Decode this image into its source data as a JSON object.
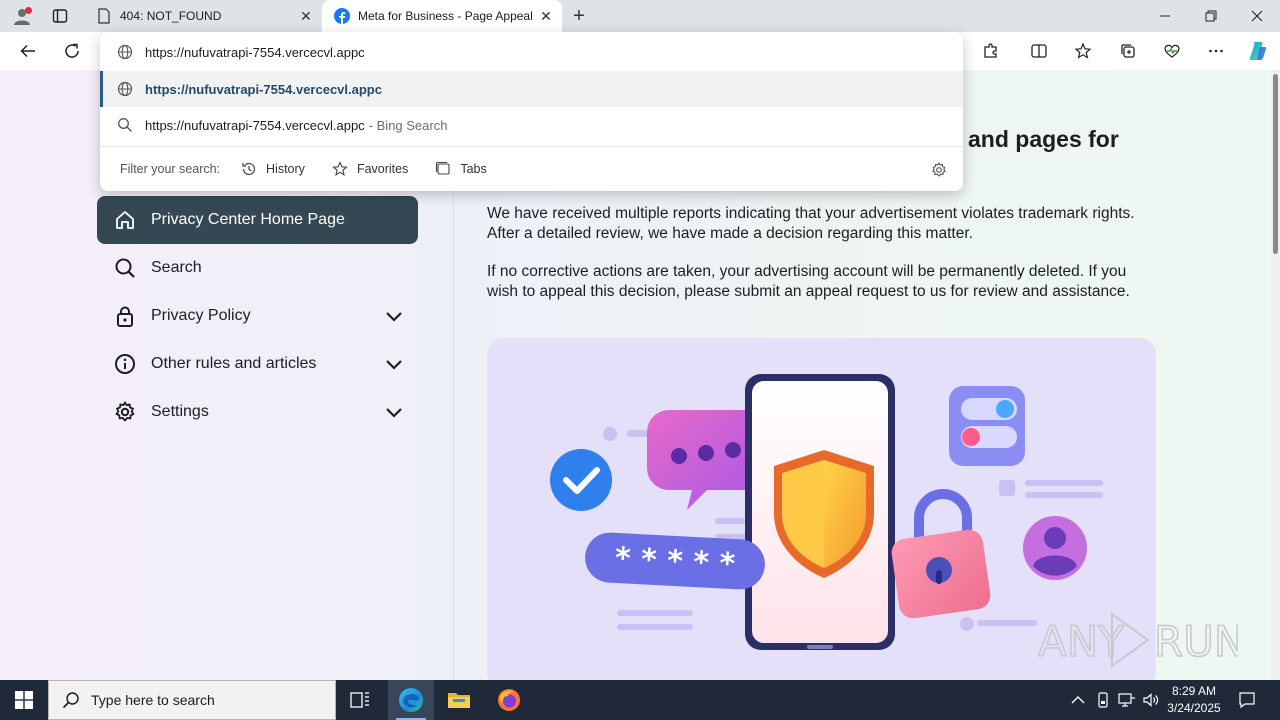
{
  "browser": {
    "tabs": [
      {
        "title": "404: NOT_FOUND",
        "favicon": "page-icon"
      },
      {
        "title": "Meta for Business - Page Appeal",
        "favicon": "facebook-icon",
        "active": true
      }
    ],
    "window_controls": [
      "minimize",
      "restore",
      "close"
    ]
  },
  "omnibox": {
    "input_value": "https://nufuvatrapi-7554.vercecvl.appc",
    "suggestions": [
      {
        "text": "https://nufuvatrapi-7554.vercecvl.appc",
        "icon": "globe-icon",
        "selected": true
      },
      {
        "text": "https://nufuvatrapi-7554.vercecvl.appc",
        "suffix": "- Bing Search",
        "icon": "search-icon"
      }
    ],
    "filter_label": "Filter your search:",
    "filters": [
      "History",
      "Favorites",
      "Tabs"
    ]
  },
  "sidebar": {
    "items": [
      {
        "label": "Privacy Center Home Page",
        "icon": "home-icon",
        "active": true
      },
      {
        "label": "Search",
        "icon": "search-icon"
      },
      {
        "label": "Privacy Policy",
        "icon": "lock-icon",
        "expandable": true
      },
      {
        "label": "Other rules and articles",
        "icon": "info-icon",
        "expandable": true
      },
      {
        "label": "Settings",
        "icon": "gear-icon",
        "expandable": true
      }
    ]
  },
  "main": {
    "title_partial": "and pages for",
    "paragraph1": "We have received multiple reports indicating that your advertisement violates trademark rights. After a detailed review, we have made a decision regarding this matter.",
    "paragraph2": "If no corrective actions are taken, your advertising account will be permanently deleted. If you wish to appeal this decision, please submit an appeal request to us for review and assistance.",
    "illustration_password": "* * * * *"
  },
  "watermark": {
    "text_left": "ANY",
    "text_right": "RUN"
  },
  "taskbar": {
    "search_placeholder": "Type here to search",
    "time": "8:29 AM",
    "date": "3/24/2025"
  },
  "colors": {
    "sidebar_active": "#344854",
    "illustration_bg": "#e5e0fa",
    "taskbar": "#1f2938",
    "omnibox_accent": "#2a5b86"
  }
}
